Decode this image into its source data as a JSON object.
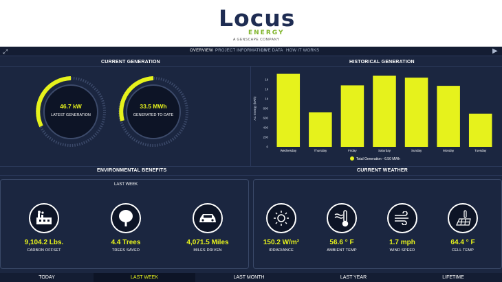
{
  "logo": {
    "main": "Locus",
    "sub": "ENERGY",
    "tagline": "A GENSCAPE COMPANY"
  },
  "nav": {
    "items": [
      "OVERVIEW",
      "PROJECT INFORMATION",
      "LIVE DATA",
      "HOW IT WORKS"
    ],
    "active": "OVERVIEW"
  },
  "current_generation": {
    "title": "CURRENT GENERATION",
    "gauges": [
      {
        "value": "46.7 kW",
        "label": "LATEST GENERATION"
      },
      {
        "value": "33.5 MWh",
        "label": "GENERATED TO DATE"
      }
    ]
  },
  "historical_generation": {
    "title": "HISTORICAL GENERATION",
    "legend": "Total Generation - 6.50 MWh"
  },
  "chart_data": {
    "type": "bar",
    "categories": [
      "Wednesday",
      "Thursday",
      "Friday",
      "Saturday",
      "Sunday",
      "Monday",
      "Tuesday"
    ],
    "values": [
      1.52,
      0.72,
      1.28,
      1.48,
      1.44,
      1.27,
      0.69
    ],
    "ylabel": "AC Energy (kWh)",
    "yticks": [
      "0",
      "200",
      "400",
      "600",
      "800",
      "1k",
      "1k",
      "1k"
    ],
    "ylim": [
      0,
      1.6
    ],
    "bar_color": "#e6f21c",
    "grid": false
  },
  "environmental": {
    "title": "ENVIRONMENTAL BENEFITS",
    "caption": "LAST WEEK",
    "stats": [
      {
        "value": "9,104.2 Lbs.",
        "label": "CARBON OFFSET",
        "icon": "factory-icon"
      },
      {
        "value": "4.4 Trees",
        "label": "TREES SAVED",
        "icon": "tree-icon"
      },
      {
        "value": "4,071.5 Miles",
        "label": "MILES DRIVEN",
        "icon": "car-icon"
      }
    ]
  },
  "weather": {
    "title": "CURRENT WEATHER",
    "stats": [
      {
        "value": "150.2 W/m²",
        "label": "IRRADIANCE",
        "icon": "sun-icon"
      },
      {
        "value": "56.6 ° F",
        "label": "AMBIENT TEMP",
        "icon": "thermometer-icon"
      },
      {
        "value": "1.7 mph",
        "label": "WIND SPEED",
        "icon": "wind-icon"
      },
      {
        "value": "64.4 ° F",
        "label": "CELL TEMP",
        "icon": "solar-panel-icon"
      }
    ]
  },
  "tabs": {
    "items": [
      "TODAY",
      "LAST WEEK",
      "LAST MONTH",
      "LAST YEAR",
      "LIFETIME"
    ],
    "active": "LAST WEEK"
  },
  "colors": {
    "accent": "#e6f21c",
    "background": "#1b2640",
    "brand": "#1e2c52",
    "brand_green": "#7fb42b"
  }
}
